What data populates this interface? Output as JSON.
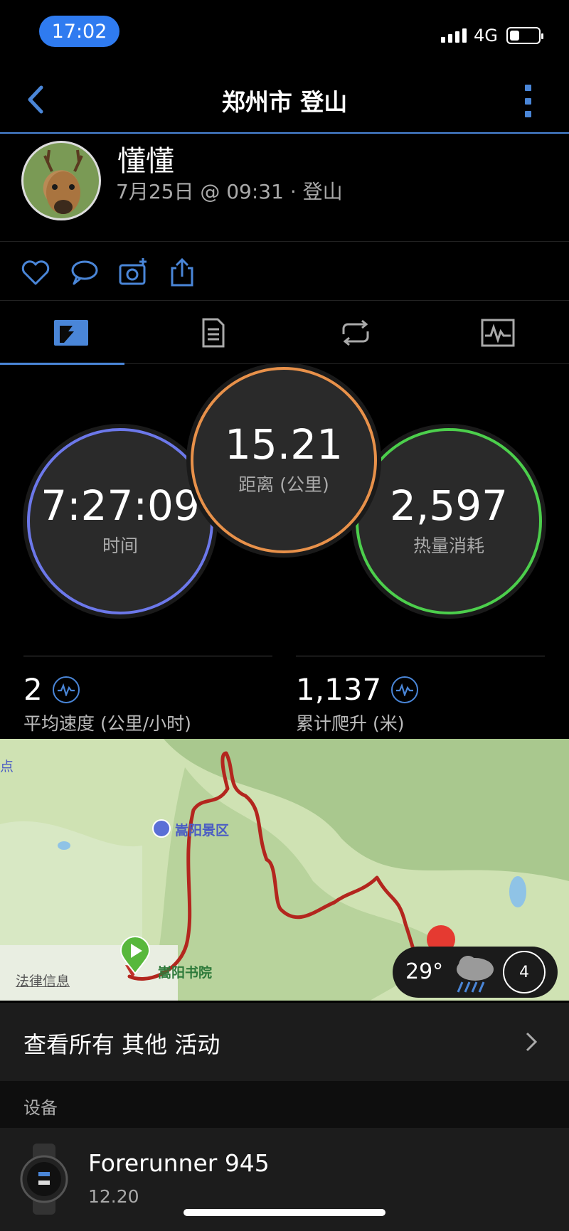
{
  "status_bar": {
    "time": "17:02",
    "network": "4G",
    "battery_level": 0.35
  },
  "header": {
    "title": "郑州市 登山"
  },
  "profile": {
    "name": "懂懂",
    "meta": "7月25日 @ 09:31 · 登山"
  },
  "metrics": {
    "duration": {
      "value": "7:27:09",
      "label": "时间",
      "color": "#6c78ea"
    },
    "distance": {
      "value": "15.21",
      "label": "距离 (公里)",
      "color": "#e8914a"
    },
    "calories": {
      "value": "2,597",
      "label": "热量消耗",
      "color": "#4ccf4c"
    }
  },
  "stats": [
    {
      "value": "2",
      "label": "平均速度 (公里/小时)"
    },
    {
      "value": "1,137",
      "label": "累计爬升 (米)"
    }
  ],
  "map": {
    "labels": {
      "scenic": "嵩阳景区",
      "academy": "嵩阳书院",
      "legal": "法律信息",
      "edge": "点"
    },
    "weather": {
      "temp": "29°",
      "uv": "4"
    }
  },
  "other_activities": {
    "label": "查看所有 其他 活动"
  },
  "devices_section": {
    "title": "设备"
  },
  "device": {
    "name": "Forerunner 945",
    "version": "12.20"
  }
}
